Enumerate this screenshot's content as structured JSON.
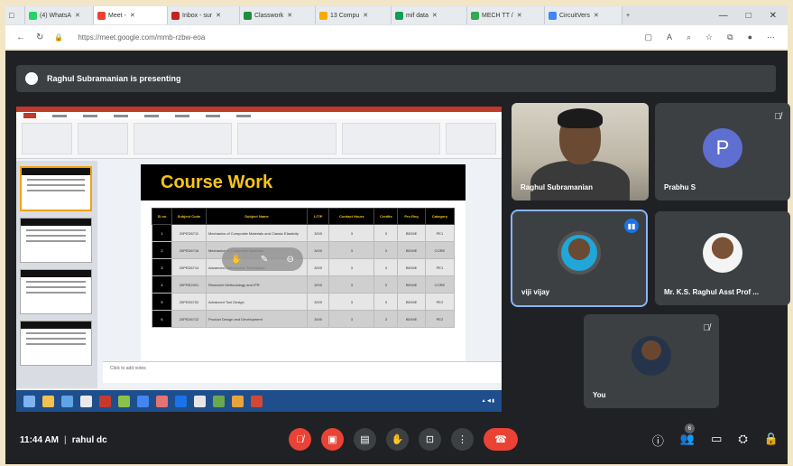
{
  "browser": {
    "tabs": [
      {
        "label": "(4) WhatsA",
        "color": "#25d366",
        "active": false
      },
      {
        "label": "Meet -",
        "color": "#ea4335",
        "active": true
      },
      {
        "label": "Inbox - sur",
        "color": "#c5221f",
        "active": false
      },
      {
        "label": "Classwork",
        "color": "#1e8e3e",
        "active": false
      },
      {
        "label": "13 Compu",
        "color": "#f9ab00",
        "active": false
      },
      {
        "label": "mif data",
        "color": "#0f9d58",
        "active": false
      },
      {
        "label": "MECH TT /",
        "color": "#34a853",
        "active": false
      },
      {
        "label": "CircuitVers",
        "color": "#4285f4",
        "active": false
      }
    ],
    "new_tab": "+",
    "url": "https://meet.google.com/mmb-rzbw-eoa"
  },
  "meet": {
    "presenting_text": "Raghul Subramanian is presenting",
    "clock": "11:44 AM",
    "meeting_user": "rahul dc",
    "participants_count": "6"
  },
  "slide": {
    "title": "Course Work",
    "notes_placeholder": "Click to add notes",
    "table_headers": [
      "Sl.no",
      "Subject Code",
      "Subject Name",
      "L/T/P",
      "Contact Hours",
      "Credits",
      "Pre-Req",
      "Category"
    ],
    "rows": [
      [
        "1",
        "20PED6711",
        "Mechanics of Composite Materials and Classic Elasticity",
        "3/0/0",
        "3",
        "3",
        "BE/ME",
        "PE1"
      ],
      [
        "2",
        "20PED6716",
        "Mechanics of Composite Materials",
        "3/0/0",
        "3",
        "3",
        "BE/ME",
        "CORE"
      ],
      [
        "3",
        "20PED6714",
        "Advanced Optimization Techniques",
        "3/0/0",
        "3",
        "3",
        "BE/ME",
        "PE1"
      ],
      [
        "4",
        "20PRE2001",
        "Research Methodology and IPR",
        "3/0/0",
        "3",
        "3",
        "BE/ME",
        "CORE"
      ],
      [
        "5",
        "20PED6702",
        "Advanced Tool Design",
        "3/0/0",
        "3",
        "3",
        "BE/ME",
        "PE2"
      ],
      [
        "6",
        "20PED6712",
        "Product Design and Development",
        "3/0/0",
        "3",
        "3",
        "BE/ME",
        "PE2"
      ]
    ]
  },
  "tiles": {
    "cam_name": "Raghul Subramanian",
    "prabhu_name": "Prabhu S",
    "prabhu_initial": "P",
    "viji_name": "viji vijay",
    "raghul_prof_name": "Mr. K.S. Raghul Asst Prof ...",
    "you_name": "You"
  },
  "colors": {
    "meet_bg": "#202124",
    "tile_bg": "#3c4043",
    "end_call_red": "#ea4335",
    "slide_title_yellow": "#f5c518"
  },
  "icons": {
    "mic": "mic-off-icon",
    "camera": "camera-off-icon",
    "captions": "captions-icon",
    "hand": "raise-hand-icon",
    "present": "present-icon",
    "more": "more-options-icon",
    "end": "end-call-icon",
    "info": "info-icon",
    "people": "people-icon",
    "chat": "chat-icon",
    "activities": "activities-icon",
    "host": "host-controls-icon"
  }
}
